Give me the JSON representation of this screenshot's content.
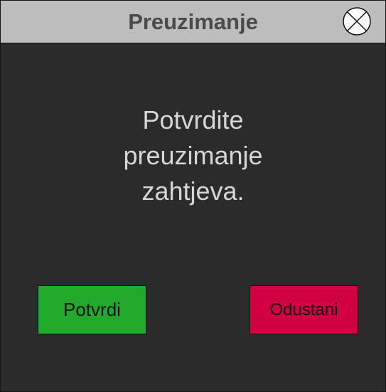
{
  "dialog": {
    "title": "Preuzimanje",
    "message": "Potvrdite preuzimanje zahtjeva.",
    "close_icon": "close-circle-x-icon"
  },
  "buttons": {
    "confirm_label": "Potvrdi",
    "cancel_label": "Odustani"
  },
  "colors": {
    "titlebar": "#bdbdbd",
    "background": "#2b2b2b",
    "confirm": "#22a92b",
    "cancel": "#d10043",
    "message_text": "#d6d6d6"
  }
}
